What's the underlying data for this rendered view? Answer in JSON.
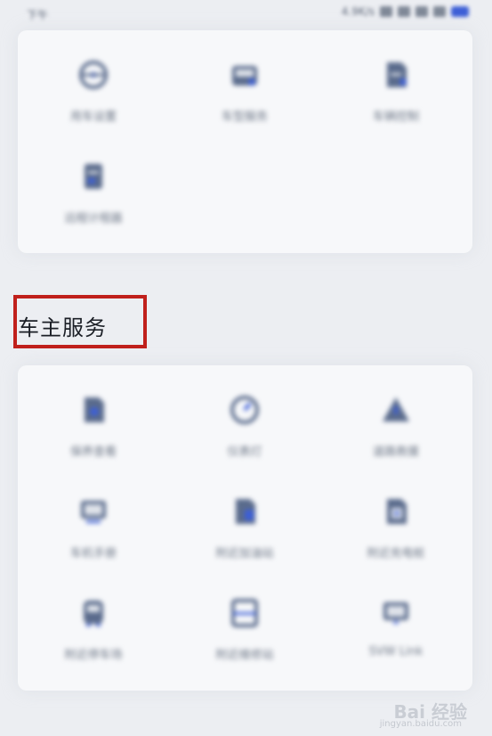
{
  "status_bar": {
    "time": "下午",
    "indicators": "4.9K/s"
  },
  "section_title": "车主服务",
  "top_grid": [
    {
      "label": "用车设置",
      "icon": "steering-wheel-icon"
    },
    {
      "label": "车型服务",
      "icon": "car-service-icon"
    },
    {
      "label": "车辆控制",
      "icon": "document-edit-icon"
    },
    {
      "label": "远程计程器",
      "icon": "clipboard-icon"
    }
  ],
  "service_grid": [
    {
      "label": "保养查看",
      "icon": "document-icon"
    },
    {
      "label": "仪表灯",
      "icon": "gauge-icon"
    },
    {
      "label": "道路救援",
      "icon": "warning-triangle-icon"
    },
    {
      "label": "车机手册",
      "icon": "monitor-icon"
    },
    {
      "label": "附近加油站",
      "icon": "fuel-doc-icon"
    },
    {
      "label": "附近充电桩",
      "icon": "charge-doc-icon"
    },
    {
      "label": "附近停车场",
      "icon": "bus-icon"
    },
    {
      "label": "附近维修站",
      "icon": "panel-icon"
    },
    {
      "label": "SVW Link",
      "icon": "display-icon"
    }
  ],
  "watermark": "Bai 经验",
  "watermark_url": "jingyan.baidu.com",
  "colors": {
    "icon": "#5a6b8c",
    "icon_accent": "#3d5fd6",
    "highlight": "#c0201c",
    "background": "#eceef2"
  }
}
